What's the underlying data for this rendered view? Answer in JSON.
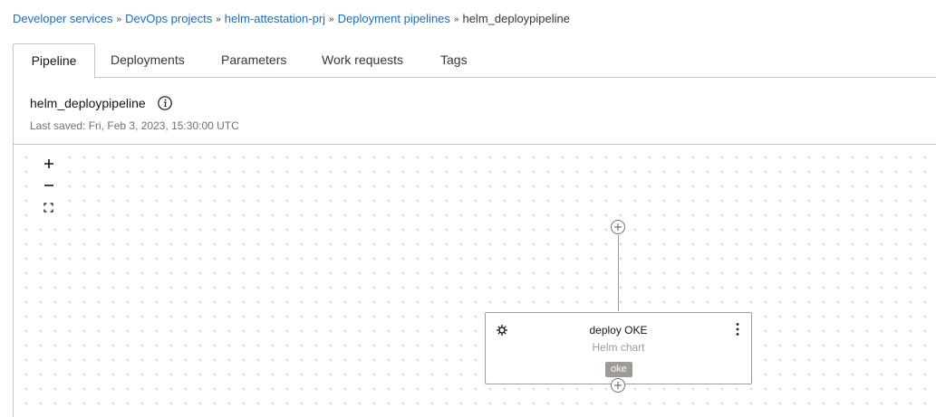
{
  "breadcrumb": {
    "items": [
      {
        "label": "Developer services"
      },
      {
        "label": "DevOps projects"
      },
      {
        "label": "helm-attestation-prj"
      },
      {
        "label": "Deployment pipelines"
      }
    ],
    "current": "helm_deploypipeline",
    "separator": "»"
  },
  "tabs": [
    {
      "label": "Pipeline",
      "active": true
    },
    {
      "label": "Deployments"
    },
    {
      "label": "Parameters"
    },
    {
      "label": "Work requests"
    },
    {
      "label": "Tags"
    }
  ],
  "pipeline": {
    "title": "helm_deploypipeline",
    "last_saved": "Last saved: Fri, Feb 3, 2023, 15:30:00 UTC"
  },
  "zoom_controls": {
    "zoom_in": "+",
    "zoom_out": "−"
  },
  "stage": {
    "name": "deploy OKE",
    "type": "Helm chart",
    "badge": "oke"
  },
  "colors": {
    "link": "#1f6bb3",
    "border": "#c7c5c1",
    "badge_bg": "#9e9a94"
  }
}
